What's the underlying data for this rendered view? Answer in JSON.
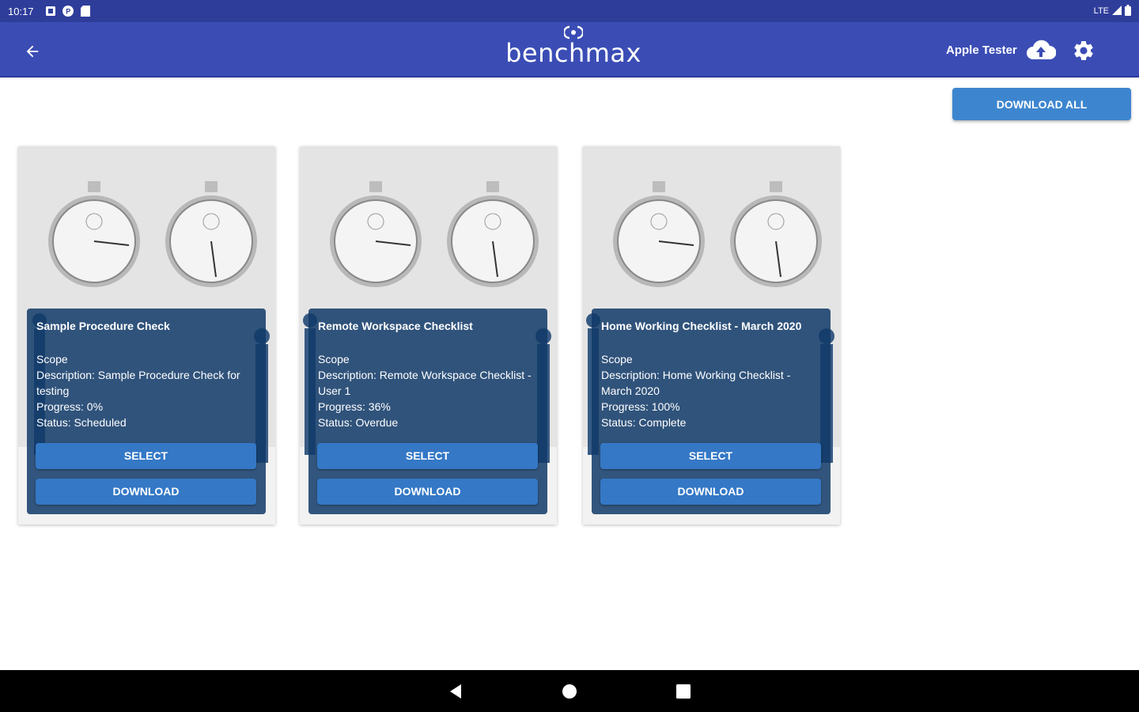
{
  "status_bar": {
    "time": "10:17",
    "network": "LTE",
    "icons": [
      "notification-icon",
      "app-icon",
      "sd-card-icon"
    ]
  },
  "app_bar": {
    "brand": "benchmax",
    "user_name": "Apple Tester",
    "colors": {
      "primary": "#3b4db5",
      "status": "#2f3d9a"
    }
  },
  "toolbar": {
    "download_all_label": "DOWNLOAD ALL"
  },
  "cards": [
    {
      "title": "Sample Procedure Check",
      "scope": "Scope",
      "description": "Description: Sample Procedure Check for testing",
      "progress": "Progress: 0%",
      "status": "Status: Scheduled",
      "select_label": "SELECT",
      "download_label": "DOWNLOAD"
    },
    {
      "title": "Remote Workspace Checklist",
      "scope": "Scope",
      "description": "Description: Remote Workspace Checklist - User 1",
      "progress": "Progress: 36%",
      "status": "Status: Overdue",
      "select_label": "SELECT",
      "download_label": "DOWNLOAD"
    },
    {
      "title": "Home Working Checklist - March 2020",
      "scope": "Scope",
      "description": "Description: Home Working Checklist - March 2020",
      "progress": "Progress: 100%",
      "status": "Status: Complete",
      "select_label": "SELECT",
      "download_label": "DOWNLOAD"
    }
  ]
}
